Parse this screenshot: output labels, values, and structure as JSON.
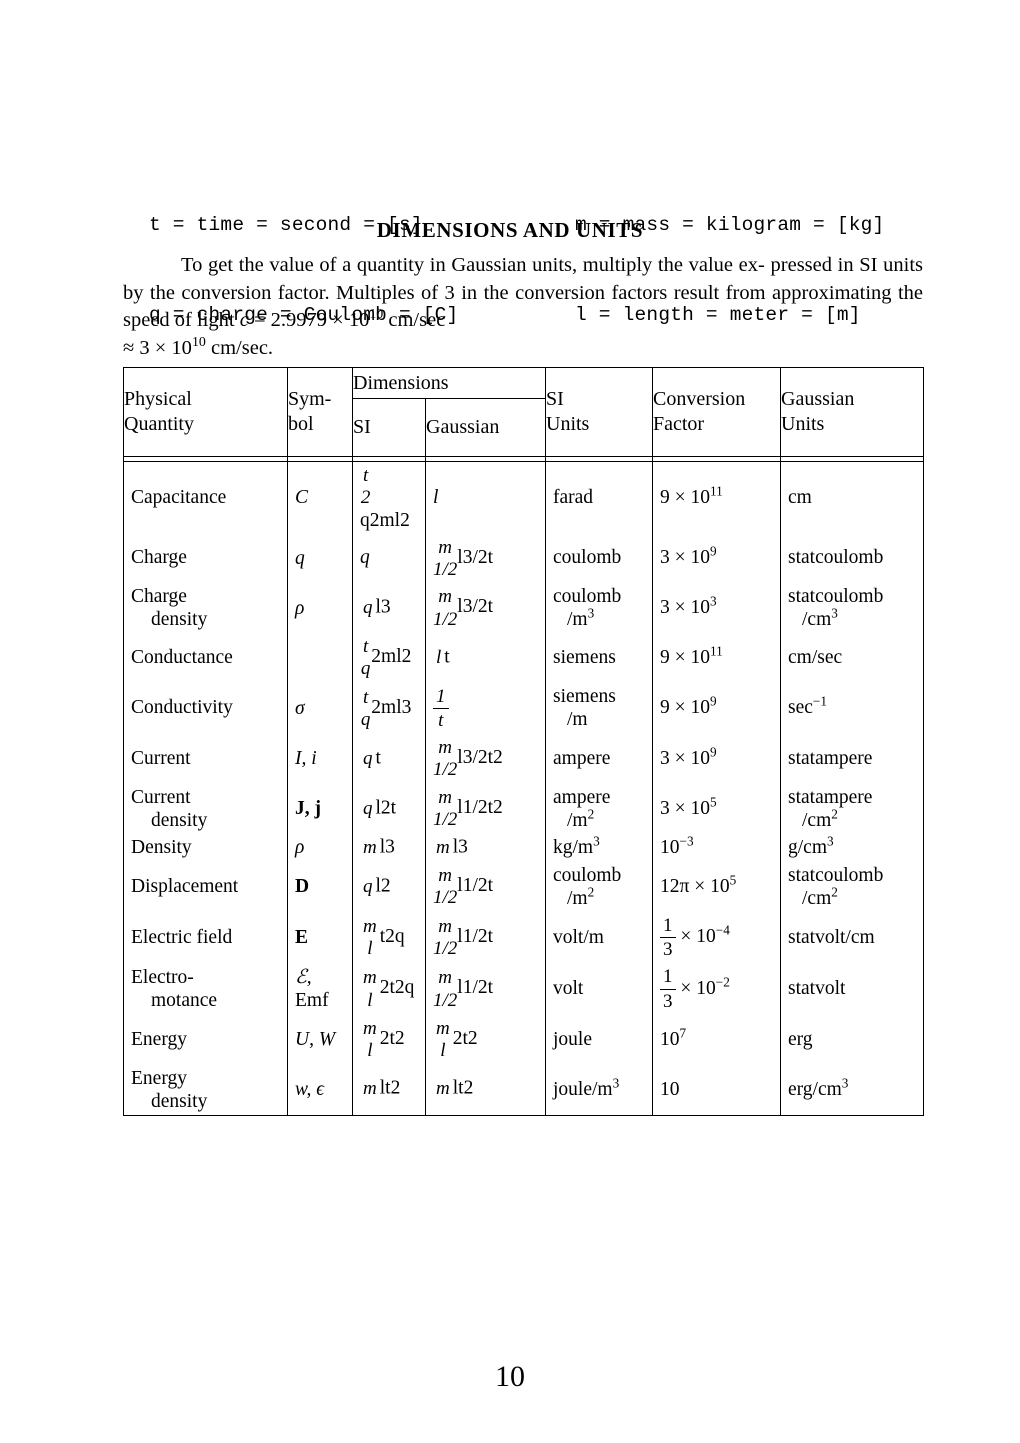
{
  "definitions": [
    {
      "left": "t = time = second = [s]",
      "right": "m = mass = kilogram = [kg]"
    },
    {
      "left": "q = charge = Coulomb = [C]",
      "right": "l = length = meter = [m]"
    }
  ],
  "section_title": "DIMENSIONS AND UNITS",
  "intro": {
    "line1": "To get the value of a quantity in Gaussian units, multiply the value ex-",
    "line2": "pressed in SI units by the conversion factor. Multiples of 3 in the conversion",
    "line3_a": "factors result from approximating the speed of light ",
    "line3_c": "c",
    "line3_eq": " = 2.9979 × 10",
    "line3_exp": "10",
    "line3_tail": " cm/sec",
    "line4_a": "≈ 3 × 10",
    "line4_exp": "10",
    "line4_tail": " cm/sec."
  },
  "table": {
    "headers": {
      "physical_quantity": [
        "Physical",
        "Quantity"
      ],
      "symbol": [
        "Sym-",
        "bol"
      ],
      "dimensions": "Dimensions",
      "si": "SI",
      "gaussian": "Gaussian",
      "si_units": [
        "SI",
        "Units"
      ],
      "conversion_factor": [
        "Conversion",
        "Factor"
      ],
      "gaussian_units": [
        "Gaussian",
        "Units"
      ]
    },
    "rows": [
      {
        "name1": "Capacitance",
        "name2": "",
        "symbol": "C",
        "symbol_style": "italic",
        "symbol2": "",
        "si_dim": {
          "kind": "frac",
          "num_base": "t",
          "num": "t²q²",
          "den": "ml²"
        },
        "ga_dim": {
          "kind": "plain",
          "text": "l"
        },
        "si_units1": "farad",
        "si_units2": "",
        "conv_mant": "9 × 10",
        "conv_exp": "11",
        "conv_frac": null,
        "gu1": "cm",
        "gu2": ""
      },
      {
        "name1": "Charge",
        "name2": "",
        "symbol": "q",
        "symbol_style": "italic",
        "symbol2": "",
        "si_dim": {
          "kind": "plain",
          "text": "q"
        },
        "ga_dim": {
          "kind": "frac",
          "num": "m^1/2 l^3/2",
          "den": "t"
        },
        "si_units1": "coulomb",
        "si_units2": "",
        "conv_mant": "3 × 10",
        "conv_exp": "9",
        "conv_frac": null,
        "gu1": "statcoulomb",
        "gu2": ""
      },
      {
        "name1": "Charge",
        "name2": "density",
        "symbol": "ρ",
        "symbol_style": "italic",
        "symbol2": "",
        "si_dim": {
          "kind": "frac",
          "num": "q",
          "den": "l³"
        },
        "ga_dim": {
          "kind": "frac",
          "num": "m^1/2",
          "den": "l^3/2 t"
        },
        "si_units1": "coulomb",
        "si_units2": "/m³",
        "conv_mant": "3 × 10",
        "conv_exp": "3",
        "conv_frac": null,
        "gu1": "statcoulomb",
        "gu2": "/cm³"
      },
      {
        "name1": "Conductance",
        "name2": "",
        "symbol": "",
        "symbol_style": "italic",
        "symbol2": "",
        "si_dim": {
          "kind": "frac",
          "num": "tq²",
          "den": "ml²"
        },
        "ga_dim": {
          "kind": "frac",
          "num": "l",
          "den": "t"
        },
        "si_units1": "siemens",
        "si_units2": "",
        "conv_mant": "9 × 10",
        "conv_exp": "11",
        "conv_frac": null,
        "gu1": "cm/sec",
        "gu2": ""
      },
      {
        "name1": "Conductivity",
        "name2": "",
        "symbol": "σ",
        "symbol_style": "italic",
        "symbol2": "",
        "si_dim": {
          "kind": "frac",
          "num": "tq²",
          "den": "ml³"
        },
        "ga_dim": {
          "kind": "frac",
          "num": "1",
          "den": "t"
        },
        "si_units1": "siemens",
        "si_units2": "/m",
        "conv_mant": "9 × 10",
        "conv_exp": "9",
        "conv_frac": null,
        "gu1": "sec⁻¹",
        "gu2": ""
      },
      {
        "name1": "Current",
        "name2": "",
        "symbol": "I, i",
        "symbol_style": "italic",
        "symbol2": "",
        "si_dim": {
          "kind": "frac",
          "num": "q",
          "den": "t"
        },
        "ga_dim": {
          "kind": "frac",
          "num": "m^1/2 l^3/2",
          "den": "t²"
        },
        "si_units1": "ampere",
        "si_units2": "",
        "conv_mant": "3 × 10",
        "conv_exp": "9",
        "conv_frac": null,
        "gu1": "statampere",
        "gu2": ""
      },
      {
        "name1": "Current",
        "name2": "density",
        "symbol": "J, j",
        "symbol_style": "bold",
        "symbol2": "",
        "si_dim": {
          "kind": "frac",
          "num": "q",
          "den": "l²t"
        },
        "ga_dim": {
          "kind": "frac",
          "num": "m^1/2",
          "den": "l^1/2 t²"
        },
        "si_units1": "ampere",
        "si_units2": "/m²",
        "conv_mant": "3 × 10",
        "conv_exp": "5",
        "conv_frac": null,
        "gu1": "statampere",
        "gu2": "/cm²"
      },
      {
        "name1": "Density",
        "name2": "",
        "symbol": "ρ",
        "symbol_style": "italic",
        "symbol2": "",
        "si_dim": {
          "kind": "frac",
          "num": "m",
          "den": "l³"
        },
        "ga_dim": {
          "kind": "frac",
          "num": "m",
          "den": "l³"
        },
        "si_units1": "kg/m³",
        "si_units2": "",
        "conv_mant": "10",
        "conv_exp": "−3",
        "conv_frac": null,
        "gu1": "g/cm³",
        "gu2": ""
      },
      {
        "name1": "Displacement",
        "name2": "",
        "symbol": "D",
        "symbol_style": "bold",
        "symbol2": "",
        "si_dim": {
          "kind": "frac",
          "num": "q",
          "den": "l²"
        },
        "ga_dim": {
          "kind": "frac",
          "num": "m^1/2",
          "den": "l^1/2 t"
        },
        "si_units1": "coulomb",
        "si_units2": "/m²",
        "conv_mant": "12π × 10",
        "conv_exp": "5",
        "conv_frac": null,
        "gu1": "statcoulomb",
        "gu2": "/cm²"
      },
      {
        "name1": "Electric field",
        "name2": "",
        "symbol": "E",
        "symbol_style": "bold",
        "symbol2": "",
        "si_dim": {
          "kind": "frac",
          "num": "ml",
          "den": "t²q"
        },
        "ga_dim": {
          "kind": "frac",
          "num": "m^1/2",
          "den": "l^1/2 t"
        },
        "si_units1": "volt/m",
        "si_units2": "",
        "conv_mant": null,
        "conv_exp": "−4",
        "conv_frac": {
          "num": "1",
          "den": "3"
        },
        "gu1": "statvolt/cm",
        "gu2": ""
      },
      {
        "name1": "Electro-",
        "name2": "motance",
        "symbol": "ℰ,",
        "symbol_style": "script",
        "symbol2": "Emf",
        "si_dim": {
          "kind": "frac",
          "num": "ml²",
          "den": "t²q"
        },
        "ga_dim": {
          "kind": "frac",
          "num": "m^1/2 l^1/2",
          "den": "t"
        },
        "si_units1": "volt",
        "si_units2": "",
        "conv_mant": null,
        "conv_exp": "−2",
        "conv_frac": {
          "num": "1",
          "den": "3"
        },
        "gu1": "statvolt",
        "gu2": ""
      },
      {
        "name1": "Energy",
        "name2": "",
        "symbol": "U, W",
        "symbol_style": "italic",
        "symbol2": "",
        "si_dim": {
          "kind": "frac",
          "num": "ml²",
          "den": "t²"
        },
        "ga_dim": {
          "kind": "frac",
          "num": "ml²",
          "den": "t²"
        },
        "si_units1": "joule",
        "si_units2": "",
        "conv_mant": "10",
        "conv_exp": "7",
        "conv_frac": null,
        "gu1": "erg",
        "gu2": ""
      },
      {
        "name1": "Energy",
        "name2": "density",
        "symbol": "w, ϵ",
        "symbol_style": "italic",
        "symbol2": "",
        "si_dim": {
          "kind": "frac",
          "num": "m",
          "den": "lt²"
        },
        "ga_dim": {
          "kind": "frac",
          "num": "m",
          "den": "lt²"
        },
        "si_units1": "joule/m³",
        "si_units2": "",
        "conv_mant": "10",
        "conv_exp": "",
        "conv_frac": null,
        "gu1": "erg/cm³",
        "gu2": ""
      }
    ]
  },
  "page_number": "10"
}
